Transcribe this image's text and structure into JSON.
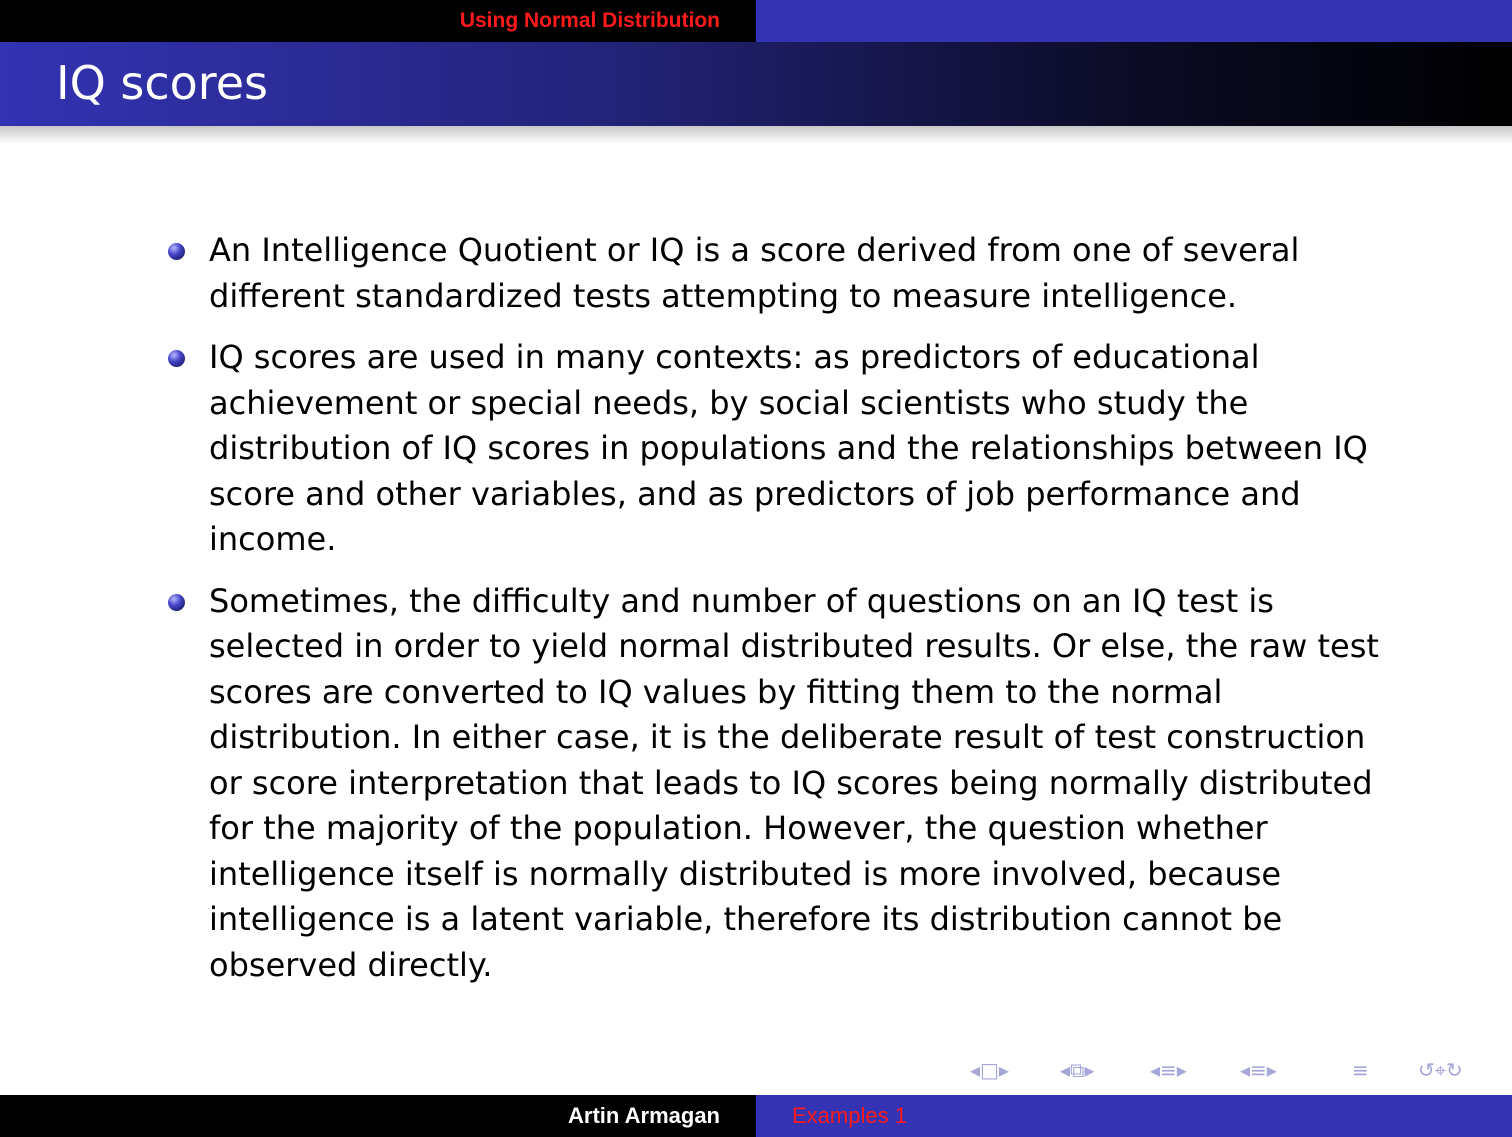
{
  "header": {
    "section": "Using Normal Distribution"
  },
  "frame": {
    "title": "IQ scores"
  },
  "bullets": [
    "An Intelligence Quotient or IQ is a score derived from one of several different standardized tests attempting to measure intelligence.",
    "IQ scores are used in many contexts: as predictors of educational achievement or special needs, by social scientists who study the distribution of IQ scores in populations and the relationships between IQ score and other variables, and as predictors of job performance and income.",
    "Sometimes, the difficulty and number of questions on an IQ test is selected in order to yield normal distributed results. Or else, the raw test scores are converted to IQ values by fitting them to the normal distribution. In either case, it is the deliberate result of test construction or score interpretation that leads to IQ scores being normally distributed for the majority of the population. However, the question whether intelligence itself is normally distributed is more involved, because intelligence is a latent variable, therefore its distribution cannot be observed directly."
  ],
  "navigation": {
    "icons": [
      "frame-nav-icon",
      "subsection-nav-icon",
      "section-nav-icon",
      "subsection-list-nav-icon",
      "document-nav-icon",
      "search-icon"
    ]
  },
  "footer": {
    "author": "Artin Armagan",
    "short_title": "Examples 1"
  },
  "colors": {
    "structure": "#3333b3",
    "alert_red": "#ff1a1a",
    "bar_black": "#000000"
  }
}
